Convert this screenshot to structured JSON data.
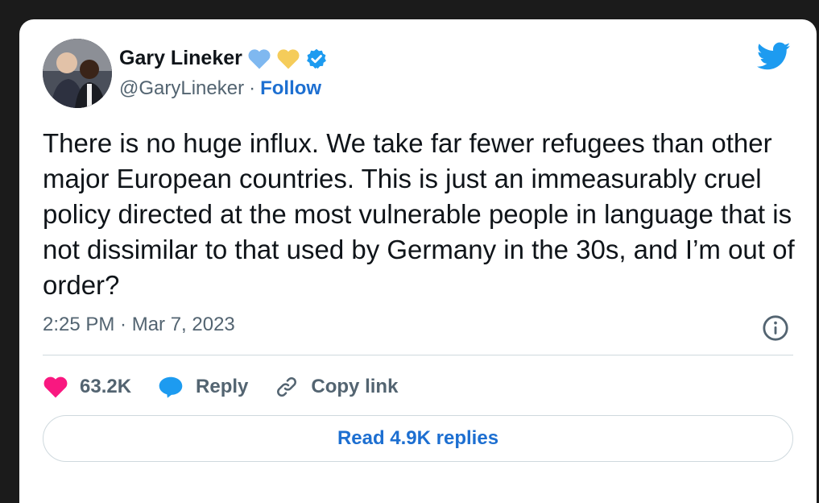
{
  "author": {
    "display_name": "Gary Lineker",
    "handle": "@GaryLineker",
    "separator": "·",
    "follow_label": "Follow",
    "badges": [
      "blue-heart-icon",
      "yellow-heart-icon",
      "verified-badge-icon"
    ]
  },
  "tweet": {
    "text": "There is no huge influx. We take far fewer refugees than other major European countries. This is just an immeasurably cruel policy directed at the most vulnerable people in language that is not dissimilar to that used by Germany in the 30s, and I’m out of order?",
    "timestamp": "2:25 PM · Mar 7, 2023"
  },
  "actions": {
    "like_count": "63.2K",
    "reply_label": "Reply",
    "copy_link_label": "Copy link"
  },
  "read_replies_label": "Read 4.9K replies",
  "colors": {
    "like": "#f91880",
    "reply": "#1d9bf0",
    "brand": "#1d9bf0",
    "link": "#1d6fd1",
    "verified": "#1d9bf0",
    "blue_heart": "#7fb8f0",
    "yellow_heart": "#f5cc5a"
  }
}
